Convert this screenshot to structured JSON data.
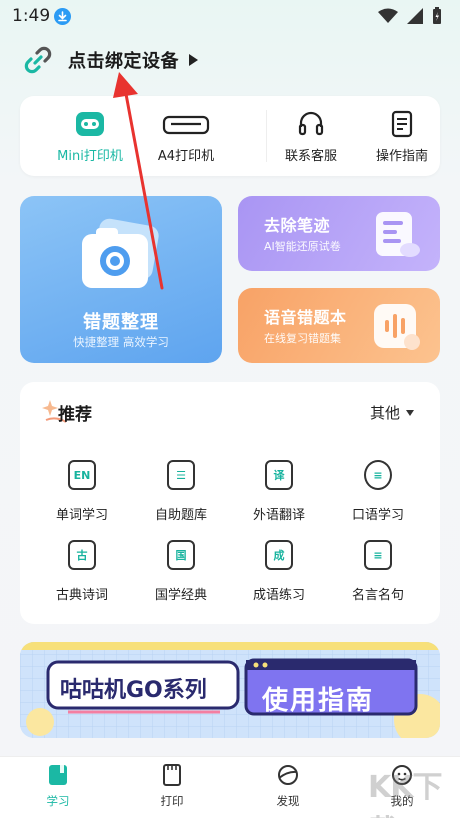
{
  "status": {
    "time": "1:49"
  },
  "bind": {
    "label": "点击绑定设备"
  },
  "devices": {
    "mini": "Mini打印机",
    "a4": "A4打印机",
    "service": "联系客服",
    "guide": "操作指南"
  },
  "features": {
    "mistakes": {
      "title": "错题整理",
      "subtitle": "快捷整理 高效学习"
    },
    "erase": {
      "title": "去除笔迹",
      "subtitle": "AI智能还原试卷"
    },
    "voice": {
      "title": "语音错题本",
      "subtitle": "在线复习错题集"
    }
  },
  "recommend": {
    "title": "推荐",
    "more": "其他",
    "items": [
      {
        "label": "单词学习",
        "glyph": "EN"
      },
      {
        "label": "自助题库",
        "glyph": "☰"
      },
      {
        "label": "外语翻译",
        "glyph": "译"
      },
      {
        "label": "口语学习",
        "glyph": "≡"
      },
      {
        "label": "古典诗词",
        "glyph": "古"
      },
      {
        "label": "国学经典",
        "glyph": "国"
      },
      {
        "label": "成语练习",
        "glyph": "成"
      },
      {
        "label": "名言名句",
        "glyph": "≡"
      }
    ]
  },
  "banner": {
    "left": "咕咕机GO系列",
    "right": "使用指南"
  },
  "tabs": [
    {
      "label": "学习"
    },
    {
      "label": "打印"
    },
    {
      "label": "发现"
    },
    {
      "label": "我的"
    }
  ],
  "watermark": "KK下载",
  "colors": {
    "accent": "#1bb8a4",
    "annotation": "#e8332f"
  }
}
